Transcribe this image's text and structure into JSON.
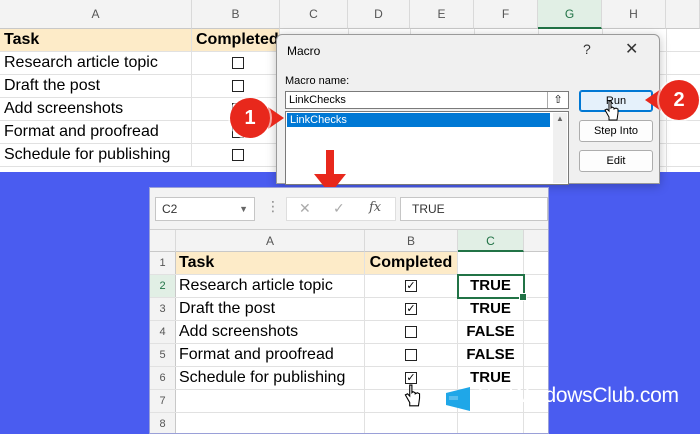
{
  "top_sheet": {
    "columns": [
      "A",
      "B",
      "C",
      "D",
      "E",
      "F",
      "G",
      "H"
    ],
    "selected_column": "G",
    "header": {
      "task": "Task",
      "completed": "Completed"
    },
    "tasks": [
      "Research article topic",
      "Draft the post",
      "Add screenshots",
      "Format and proofread",
      "Schedule for publishing"
    ]
  },
  "macro_dialog": {
    "title": "Macro",
    "help_label": "?",
    "close_label": "✕",
    "name_label": "Macro name:",
    "name_value": "LinkChecks",
    "upload_icon": "⇧",
    "list_items": [
      "LinkChecks"
    ],
    "buttons": {
      "run": "Run",
      "step_into": "Step Into",
      "edit": "Edit"
    }
  },
  "badges": {
    "one": "1",
    "two": "2"
  },
  "bottom_sheet": {
    "name_box": "C2",
    "formula_value": "TRUE",
    "fx_label": "fx",
    "columns": [
      "A",
      "B",
      "C"
    ],
    "selected_column": "C",
    "header": {
      "task": "Task",
      "completed": "Completed"
    },
    "row_numbers": [
      "1",
      "2",
      "3",
      "4",
      "5",
      "6",
      "7",
      "8"
    ],
    "rows": [
      {
        "task": "Research article topic",
        "checked": true,
        "result": "TRUE"
      },
      {
        "task": "Draft the post",
        "checked": true,
        "result": "TRUE"
      },
      {
        "task": "Add screenshots",
        "checked": false,
        "result": "FALSE"
      },
      {
        "task": "Format and proofread",
        "checked": false,
        "result": "FALSE"
      },
      {
        "task": "Schedule for publishing",
        "checked": true,
        "result": "TRUE"
      }
    ]
  },
  "watermark": {
    "text": "TheWindowsClub.com"
  },
  "colors": {
    "background_blue": "#4a5cf0",
    "header_fill": "#fdebc8",
    "excel_green": "#217346",
    "badge_red": "#e8281c",
    "selection_blue": "#0078d4"
  }
}
